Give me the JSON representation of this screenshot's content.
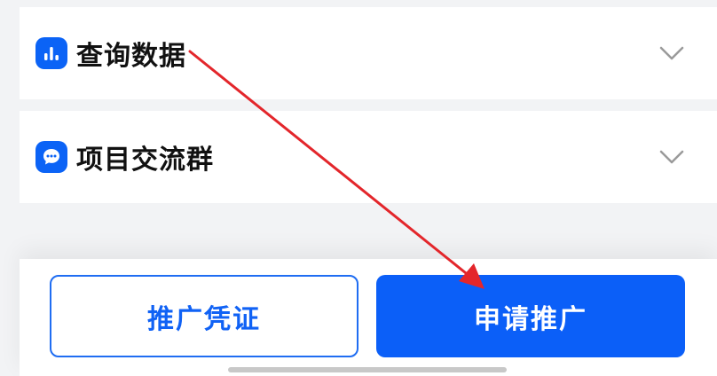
{
  "sections": {
    "query_data": {
      "title": "查询数据",
      "icon": "bar-chart-icon"
    },
    "project_group": {
      "title": "项目交流群",
      "icon": "chat-bubble-icon"
    }
  },
  "actions": {
    "promotion_proof_label": "推广凭证",
    "apply_promotion_label": "申请推广"
  },
  "colors": {
    "accent": "#0b5ff8",
    "icon_bg": "#0b63f6",
    "annotation_arrow": "#e3262b",
    "page_bg": "#f2f3f5"
  }
}
